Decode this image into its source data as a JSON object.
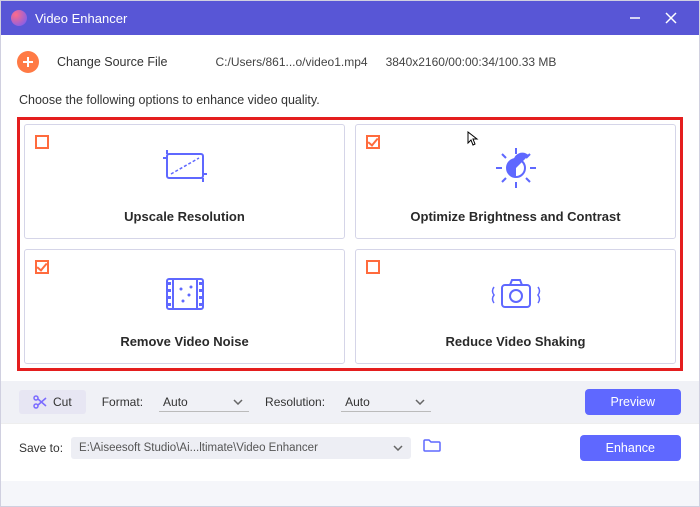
{
  "window": {
    "title": "Video Enhancer"
  },
  "source": {
    "change_label": "Change Source File",
    "path": "C:/Users/861...o/video1.mp4",
    "stats": "3840x2160/00:00:34/100.33 MB"
  },
  "instruction": "Choose the following options to enhance video quality.",
  "options": [
    {
      "label": "Upscale Resolution",
      "checked": false,
      "icon": "monitor"
    },
    {
      "label": "Optimize Brightness and Contrast",
      "checked": true,
      "icon": "brightness"
    },
    {
      "label": "Remove Video Noise",
      "checked": true,
      "icon": "film"
    },
    {
      "label": "Reduce Video Shaking",
      "checked": false,
      "icon": "camera"
    }
  ],
  "toolbar": {
    "cut_label": "Cut",
    "format_label": "Format:",
    "format_value": "Auto",
    "resolution_label": "Resolution:",
    "resolution_value": "Auto",
    "preview_label": "Preview"
  },
  "save": {
    "label": "Save to:",
    "path": "E:\\Aiseesoft Studio\\Ai...ltimate\\Video Enhancer",
    "enhance_label": "Enhance"
  }
}
